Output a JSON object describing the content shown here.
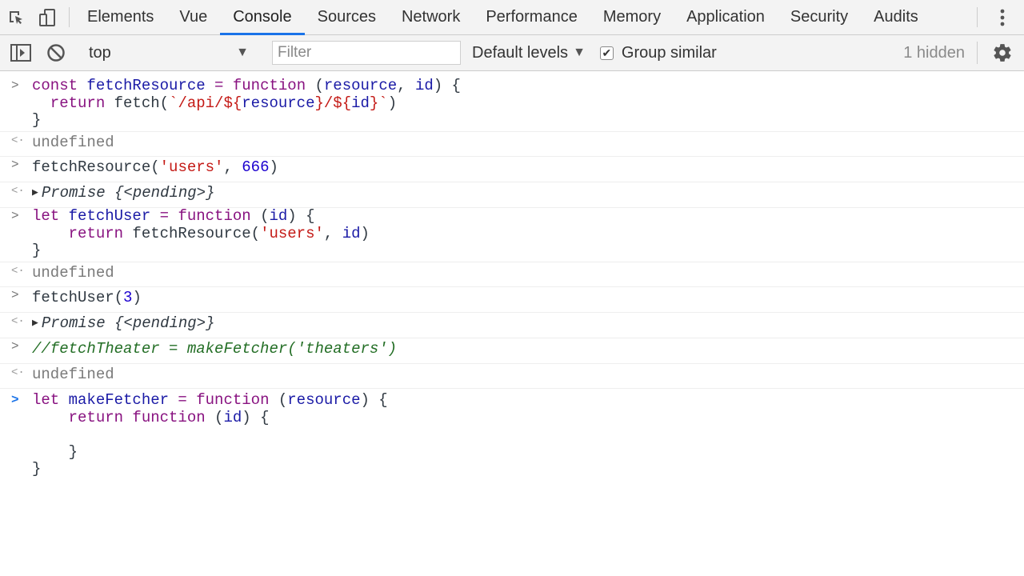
{
  "tabs": [
    {
      "label": "Elements"
    },
    {
      "label": "Vue"
    },
    {
      "label": "Console"
    },
    {
      "label": "Sources"
    },
    {
      "label": "Network"
    },
    {
      "label": "Performance"
    },
    {
      "label": "Memory"
    },
    {
      "label": "Application"
    },
    {
      "label": "Security"
    },
    {
      "label": "Audits"
    }
  ],
  "active_tab": "Console",
  "toolbar": {
    "context": "top",
    "filter_placeholder": "Filter",
    "levels_label": "Default levels",
    "group_similar_label": "Group similar",
    "group_similar_checked": true,
    "hidden_count": "1 hidden"
  },
  "console": {
    "e1": {
      "l1": {
        "a": "const ",
        "b": "fetchResource",
        "c": " = ",
        "d": "function",
        "e": " (",
        "f": "resource",
        "g": ", ",
        "h": "id",
        "i": ") {"
      },
      "l2": {
        "a": "  return ",
        "b": "fetch(",
        "c": "`/api/${",
        "d": "resource",
        "e": "}/${",
        "f": "id",
        "g": "}`",
        "h": ")"
      },
      "l3": "}"
    },
    "r1": "undefined",
    "e2": {
      "a": "fetchResource(",
      "b": "'users'",
      "c": ", ",
      "d": "666",
      "e": ")"
    },
    "r2": {
      "a": "Promise",
      "b": " {<pending>}"
    },
    "e3": {
      "l1": {
        "a": "let ",
        "b": "fetchUser",
        "c": " = ",
        "d": "function",
        "e": " (",
        "f": "id",
        "g": ") {"
      },
      "l2": {
        "a": "    return ",
        "b": "fetchResource(",
        "c": "'users'",
        "d": ", ",
        "e": "id",
        "f": ")"
      },
      "l3": "}"
    },
    "r3": "undefined",
    "e4": {
      "a": "fetchUser(",
      "b": "3",
      "c": ")"
    },
    "r4": {
      "a": "Promise",
      "b": " {<pending>}"
    },
    "e5": "//fetchTheater = makeFetcher('theaters')",
    "r5": "undefined",
    "e6": {
      "l1": {
        "a": "let ",
        "b": "makeFetcher",
        "c": " = ",
        "d": "function",
        "e": " (",
        "f": "resource",
        "g": ") {"
      },
      "l2": {
        "a": "    return ",
        "b": "function",
        "c": " (",
        "d": "id",
        "e": ") {"
      },
      "l3": "",
      "l4": "    }",
      "l5": "}"
    }
  },
  "colors": {
    "accent": "#1a73e8",
    "keyword": "#881280",
    "string": "#c41a16",
    "number": "#1c00cf",
    "comment": "#236e25"
  }
}
